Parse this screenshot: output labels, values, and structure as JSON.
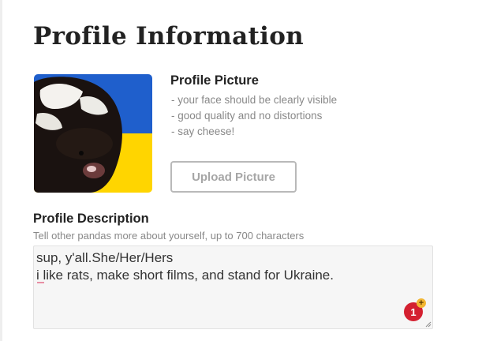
{
  "page": {
    "title": "Profile Information"
  },
  "profile_picture": {
    "heading": "Profile Picture",
    "tips": [
      "- your face should be clearly visible",
      "- good quality and no distortions",
      "- say cheese!"
    ],
    "upload_label": "Upload Picture",
    "flag_colors": {
      "top": "#1f5fcc",
      "bottom": "#ffd500"
    }
  },
  "profile_description": {
    "heading": "Profile Description",
    "hint": "Tell other pandas more about yourself, up to 700 characters",
    "lines": [
      "sup, y'all.She/Her/Hers",
      "i like rats, make short films, and stand for Ukraine."
    ]
  },
  "extension_badge": {
    "count": "1",
    "plus": "+"
  },
  "colors": {
    "badge": "#d42030",
    "muted_text": "#888888",
    "button_border": "#b9b9b9"
  }
}
